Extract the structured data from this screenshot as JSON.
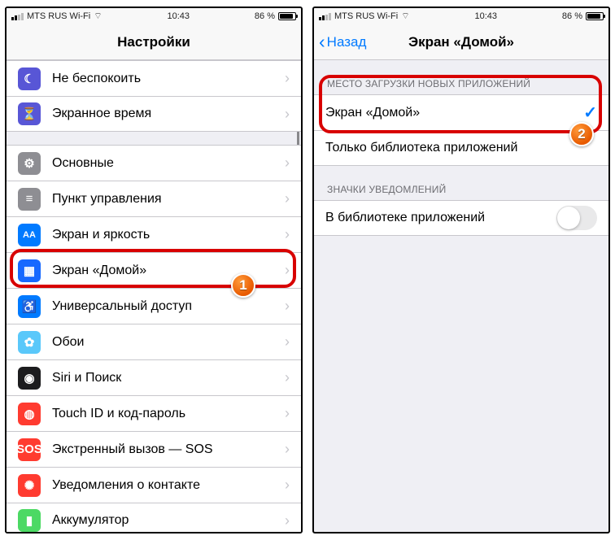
{
  "status": {
    "carrier": "MTS RUS Wi-Fi",
    "time": "10:43",
    "battery": "86 %"
  },
  "left": {
    "title": "Настройки",
    "groups": [
      {
        "items": [
          {
            "icon": "moon-icon",
            "color": "ic-purple",
            "glyph": "☾",
            "label": "Не беспокоить"
          },
          {
            "icon": "hourglass-icon",
            "color": "ic-purple",
            "glyph": "⏳",
            "label": "Экранное время"
          }
        ]
      },
      {
        "items": [
          {
            "icon": "gear-icon",
            "color": "ic-gray",
            "glyph": "⚙",
            "label": "Основные"
          },
          {
            "icon": "switches-icon",
            "color": "ic-gray",
            "glyph": "≡",
            "label": "Пункт управления"
          },
          {
            "icon": "text-size-icon",
            "color": "ic-blue",
            "glyph": "AA",
            "label": "Экран и яркость"
          },
          {
            "icon": "grid-icon",
            "color": "ic-darkblue",
            "glyph": "▦",
            "label": "Экран «Домой»"
          },
          {
            "icon": "accessibility-icon",
            "color": "ic-blue",
            "glyph": "♿",
            "label": "Универсальный доступ"
          },
          {
            "icon": "wallpaper-icon",
            "color": "ic-lightblue",
            "glyph": "✿",
            "label": "Обои"
          },
          {
            "icon": "siri-icon",
            "color": "ic-black",
            "glyph": "◉",
            "label": "Siri и Поиск"
          },
          {
            "icon": "touchid-icon",
            "color": "ic-red",
            "glyph": "◍",
            "label": "Touch ID и код-пароль"
          },
          {
            "icon": "sos-icon",
            "color": "ic-sos",
            "glyph": "SOS",
            "label": "Экстренный вызов — SOS"
          },
          {
            "icon": "exposure-icon",
            "color": "ic-red",
            "glyph": "✺",
            "label": "Уведомления о контакте"
          },
          {
            "icon": "battery-icon",
            "color": "ic-green",
            "glyph": "▮",
            "label": "Аккумулятор"
          }
        ]
      }
    ],
    "highlight_index": 3
  },
  "right": {
    "back": "Назад",
    "title": "Экран «Домой»",
    "section1": {
      "header": "МЕСТО ЗАГРУЗКИ НОВЫХ ПРИЛОЖЕНИЙ",
      "items": [
        {
          "label": "Экран «Домой»",
          "selected": true
        },
        {
          "label": "Только библиотека приложений",
          "selected": false
        }
      ]
    },
    "section2": {
      "header": "ЗНАЧКИ УВЕДОМЛЕНИЙ",
      "items": [
        {
          "label": "В библиотеке приложений",
          "toggle": false
        }
      ]
    }
  },
  "annotations": {
    "badge1": "1",
    "badge2": "2"
  }
}
